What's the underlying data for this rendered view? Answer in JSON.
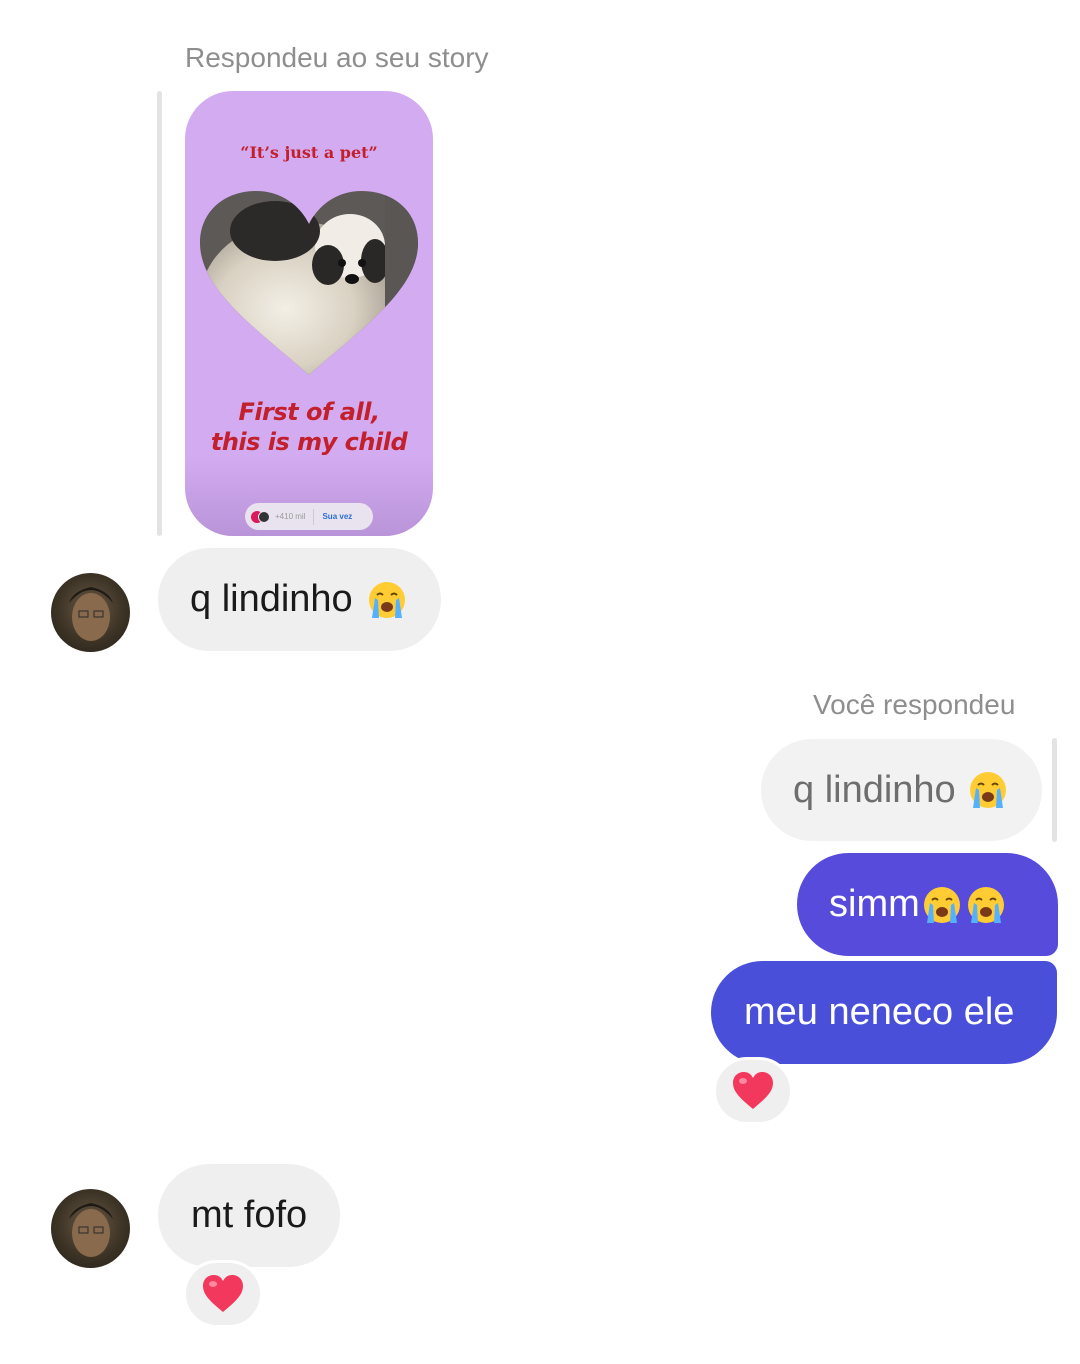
{
  "colors": {
    "outgoing_bubble": "#5145d9",
    "incoming_bubble": "#efefef",
    "story_background": "#d3abf1",
    "story_text": "#c2202c",
    "reaction_heart": "#f2395d"
  },
  "story_reply": {
    "label": "Respondeu ao seu story",
    "story": {
      "quote": "“It’s just a pet”",
      "caption_line1": "First of all,",
      "caption_line2": "this is my child",
      "reply_count": "+410 mil",
      "cta": "Sua vez"
    }
  },
  "messages": {
    "m1": {
      "text": "q lindinho",
      "emoji": "crying-face"
    },
    "your_reply_label": "Você respondeu",
    "quoted": {
      "text": "q lindinho",
      "emoji": "crying-face"
    },
    "m2": {
      "text": "simm",
      "emoji": "crying-face x2"
    },
    "m3": {
      "text": "meu neneco ele",
      "reaction": "red-heart"
    },
    "m4": {
      "text": "mt fofo",
      "reaction": "red-heart"
    }
  }
}
